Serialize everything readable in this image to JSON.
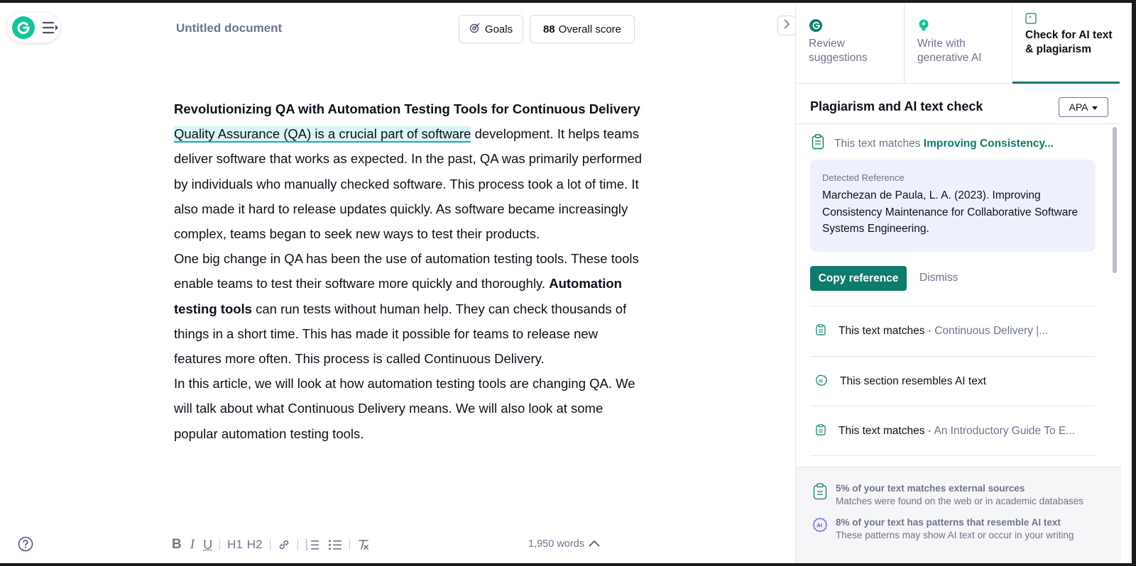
{
  "editor": {
    "doc_title": "Untitled document",
    "goals_label": "Goals",
    "score_value": "88",
    "score_label": "Overall score",
    "heading": "Revolutionizing QA with Automation Testing Tools for Continuous Delivery",
    "p1_highlight": "Quality Assurance (QA) is a crucial part of software",
    "p1_rest": " development. It helps teams deliver software that works as expected. In the past, QA was primarily performed by individuals who manually checked software. This process took a lot of time. It also made it hard to release updates quickly. As software became increasingly complex, teams began to seek new ways to test their products.",
    "p2_a": "One big change in QA has been the use of automation testing tools. These tools enable teams to test their software more quickly and thoroughly. ",
    "p2_bold": "Automation testing tools",
    "p2_b": " can run tests without human help. They can check thousands of things in a short time. This has made it possible for teams to release new features more often. This process is called Continuous Delivery.",
    "p3": "In this article, we will look at how automation testing tools are changing QA. We will talk about what Continuous Delivery means. We will also look at some popular automation testing tools.",
    "word_count": "1,950 words"
  },
  "toolbar": {
    "bold": "B",
    "italic": "I",
    "underline": "U",
    "h1": "H1",
    "h2": "H2"
  },
  "panel": {
    "tabs": [
      {
        "label": "Review suggestions",
        "icon": "grammarly-logo-icon"
      },
      {
        "label": "Write with generative AI",
        "icon": "lightbulb-icon"
      },
      {
        "label": "Check for AI text & plagiarism",
        "icon": "quote-icon"
      }
    ],
    "title": "Plagiarism and AI text check",
    "citation_style": "APA",
    "expanded": {
      "prefix": "This text matches ",
      "source": "Improving Consistency...",
      "ref_label": "Detected Reference",
      "ref_text": "Marchezan de Paula, L. A. (2023). Improving Consistency Maintenance for Collaborative Software Systems Engineering.",
      "copy_label": "Copy reference",
      "dismiss_label": "Dismiss"
    },
    "items": [
      {
        "label": "This text matches · ",
        "source": "Continuous Delivery |...",
        "icon": "clipboard-icon"
      },
      {
        "label": "This section resembles AI text",
        "source": "",
        "icon": "ai-icon"
      },
      {
        "label": "This text matches · ",
        "source": "An Introductory Guide To E...",
        "icon": "clipboard-icon"
      }
    ],
    "footer": {
      "plag_title": "5% of your text matches external sources",
      "plag_sub": "Matches were found on the web or in academic databases",
      "ai_title": "8% of your text has patterns that resemble AI text",
      "ai_sub": "These patterns may show AI text or occur in your writing"
    }
  },
  "colors": {
    "accent": "#0f7b6c",
    "brand": "#15c39a",
    "highlight": "#d9f6f7",
    "muted": "#6d758d"
  }
}
